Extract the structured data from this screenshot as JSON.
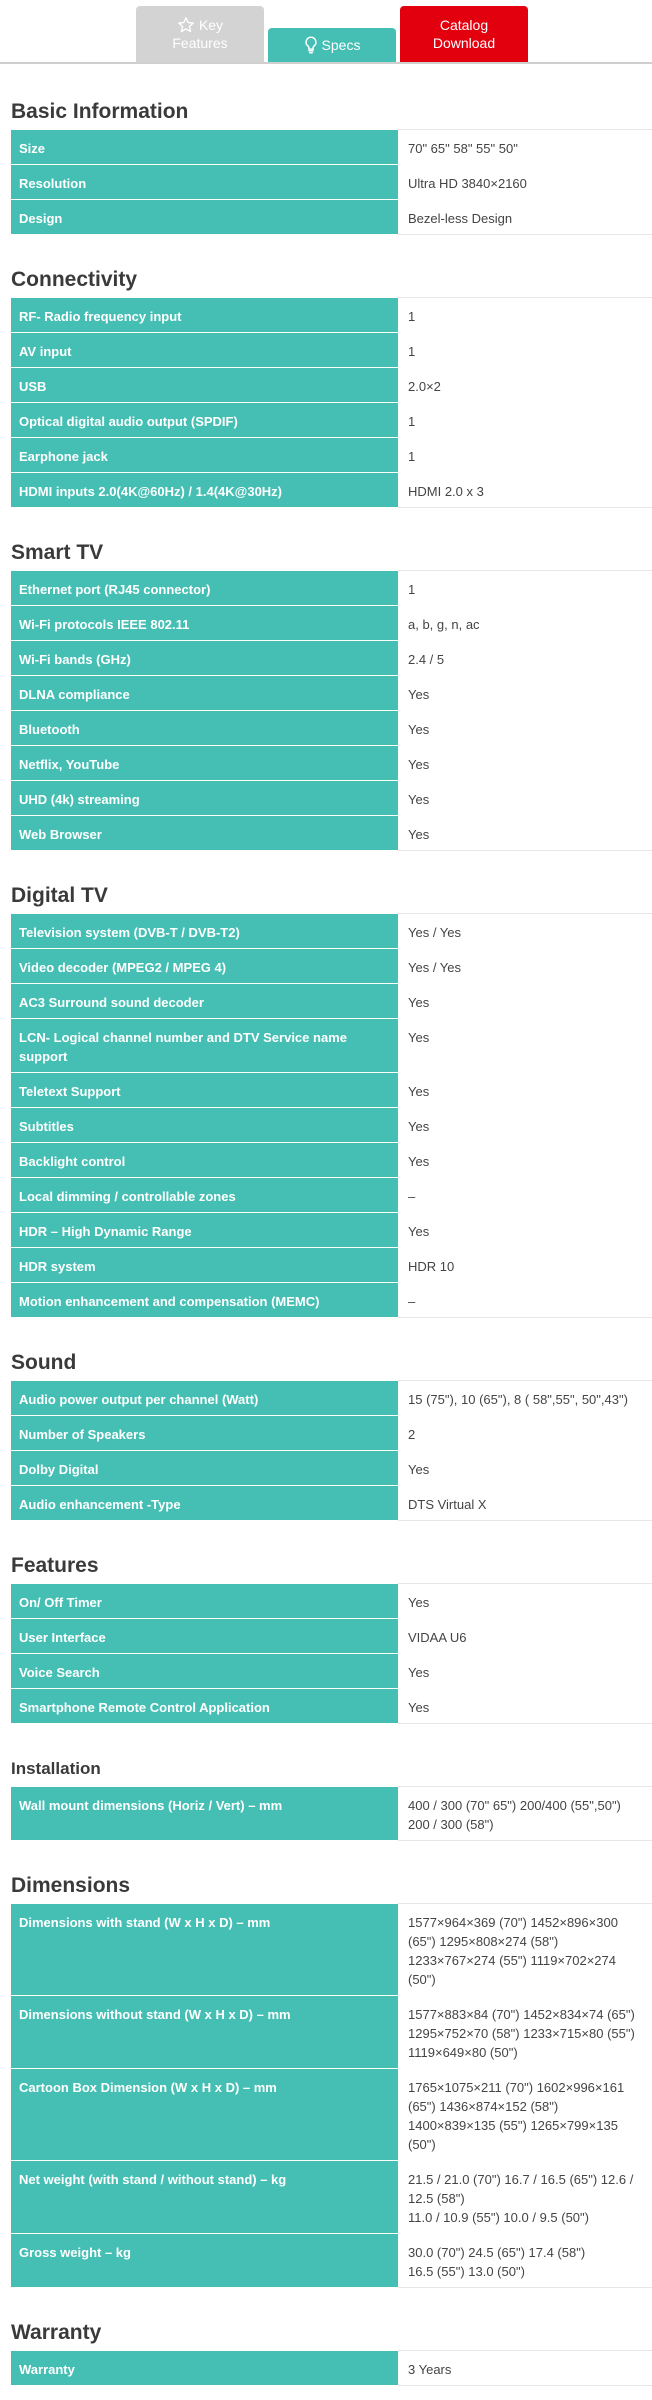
{
  "tabs": {
    "key_features": {
      "line1": "Key",
      "line2": "Features",
      "icon": "star-icon"
    },
    "specs": {
      "label": "Specs",
      "icon": "lightbulb-icon"
    },
    "catalog": {
      "line1": "Catalog",
      "line2": "Download"
    }
  },
  "colors": {
    "accent": "#45bfb3",
    "catalog": "#e2000f",
    "inactive_tab": "#d3d3d3"
  },
  "sections": [
    {
      "title": "Basic Information",
      "rows": [
        {
          "k": "Size",
          "v": "70\" 65\" 58\" 55\" 50\""
        },
        {
          "k": "Resolution",
          "v": "Ultra HD 3840×2160"
        },
        {
          "k": "Design",
          "v": "Bezel-less Design"
        }
      ]
    },
    {
      "title": "Connectivity",
      "rows": [
        {
          "k": "RF- Radio frequency input",
          "v": "1"
        },
        {
          "k": "AV input",
          "v": "1"
        },
        {
          "k": "USB",
          "v": "2.0×2"
        },
        {
          "k": "Optical digital audio output (SPDIF)",
          "v": "1"
        },
        {
          "k": "Earphone jack",
          "v": "1"
        },
        {
          "k": "HDMI inputs 2.0(4K@60Hz) / 1.4(4K@30Hz)",
          "v": "HDMI 2.0 x 3"
        }
      ]
    },
    {
      "title": "Smart TV",
      "rows": [
        {
          "k": "Ethernet port (RJ45 connector)",
          "v": "1"
        },
        {
          "k": "Wi-Fi protocols IEEE 802.11",
          "v": "a, b, g, n, ac"
        },
        {
          "k": "Wi-Fi bands (GHz)",
          "v": "2.4 / 5"
        },
        {
          "k": "DLNA compliance",
          "v": "Yes"
        },
        {
          "k": "Bluetooth",
          "v": "Yes"
        },
        {
          "k": "Netflix, YouTube",
          "v": "Yes"
        },
        {
          "k": "UHD (4k) streaming",
          "v": "Yes"
        },
        {
          "k": "Web Browser",
          "v": "Yes"
        }
      ]
    },
    {
      "title": "Digital TV",
      "rows": [
        {
          "k": "Television system (DVB-T / DVB-T2)",
          "v": "Yes / Yes"
        },
        {
          "k": "Video decoder (MPEG2 / MPEG 4)",
          "v": "Yes / Yes"
        },
        {
          "k": "AC3 Surround sound decoder",
          "v": "Yes"
        },
        {
          "k": "LCN- Logical channel number and DTV Service name support",
          "v": "Yes"
        },
        {
          "k": "Teletext Support",
          "v": "Yes"
        },
        {
          "k": "Subtitles",
          "v": "Yes"
        },
        {
          "k": "Backlight control",
          "v": "Yes"
        },
        {
          "k": "Local dimming / controllable zones",
          "v": "–"
        },
        {
          "k": "HDR – High Dynamic Range",
          "v": "Yes"
        },
        {
          "k": "HDR system",
          "v": "HDR 10"
        },
        {
          "k": "Motion enhancement and compensation (MEMC)",
          "v": "–"
        }
      ]
    },
    {
      "title": "Sound",
      "rows": [
        {
          "k": "Audio power output per channel (Watt)",
          "v": "15 (75\"), 10 (65\"), 8 ( 58\",55\", 50\",43\")"
        },
        {
          "k": "Number of Speakers",
          "v": "2"
        },
        {
          "k": "Dolby Digital",
          "v": "Yes"
        },
        {
          "k": "Audio enhancement -Type",
          "v": "DTS Virtual X"
        }
      ]
    },
    {
      "title": "Features",
      "rows": [
        {
          "k": "On/ Off Timer",
          "v": "Yes"
        },
        {
          "k": "User Interface",
          "v": "VIDAA U6"
        },
        {
          "k": "Voice Search",
          "v": "Yes"
        },
        {
          "k": "Smartphone Remote Control Application",
          "v": "Yes"
        }
      ]
    },
    {
      "title": "Installation",
      "small": true,
      "rows": [
        {
          "k": "Wall mount dimensions (Horiz / Vert) – mm",
          "v": "400 / 300 (70\" 65\")  200/400 (55\",50\")\n200 / 300 (58\")"
        }
      ]
    },
    {
      "title": "Dimensions",
      "rows": [
        {
          "k": "Dimensions with stand (W x H x D) – mm",
          "v": "1577×964×369 (70\") 1452×896×300 (65\") 1295×808×274 (58\")\n1233×767×274 (55\") 1119×702×274 (50\")"
        },
        {
          "k": "Dimensions without stand (W x H x D) – mm",
          "v": "1577×883×84 (70\") 1452×834×74 (65\") 1295×752×70 (58\") 1233×715×80 (55\")\n1119×649×80 (50\")"
        },
        {
          "k": "Cartoon Box Dimension (W x H x D) – mm",
          "v": "1765×1075×211 (70\") 1602×996×161 (65\") 1436×874×152 (58\") 1400×839×135 (55\") 1265×799×135 (50\")"
        },
        {
          "k": "Net weight (with stand / without stand) – kg",
          "v": "21.5 / 21.0 (70\") 16.7 / 16.5 (65\") 12.6 / 12.5 (58\")\n11.0 / 10.9 (55\") 10.0 / 9.5 (50\")"
        },
        {
          "k": "Gross weight – kg",
          "v": "30.0 (70\") 24.5 (65\") 17.4 (58\")\n16.5 (55\") 13.0 (50\")"
        }
      ]
    },
    {
      "title": "Warranty",
      "rows": [
        {
          "k": "Warranty",
          "v": "3 Years"
        }
      ]
    }
  ]
}
